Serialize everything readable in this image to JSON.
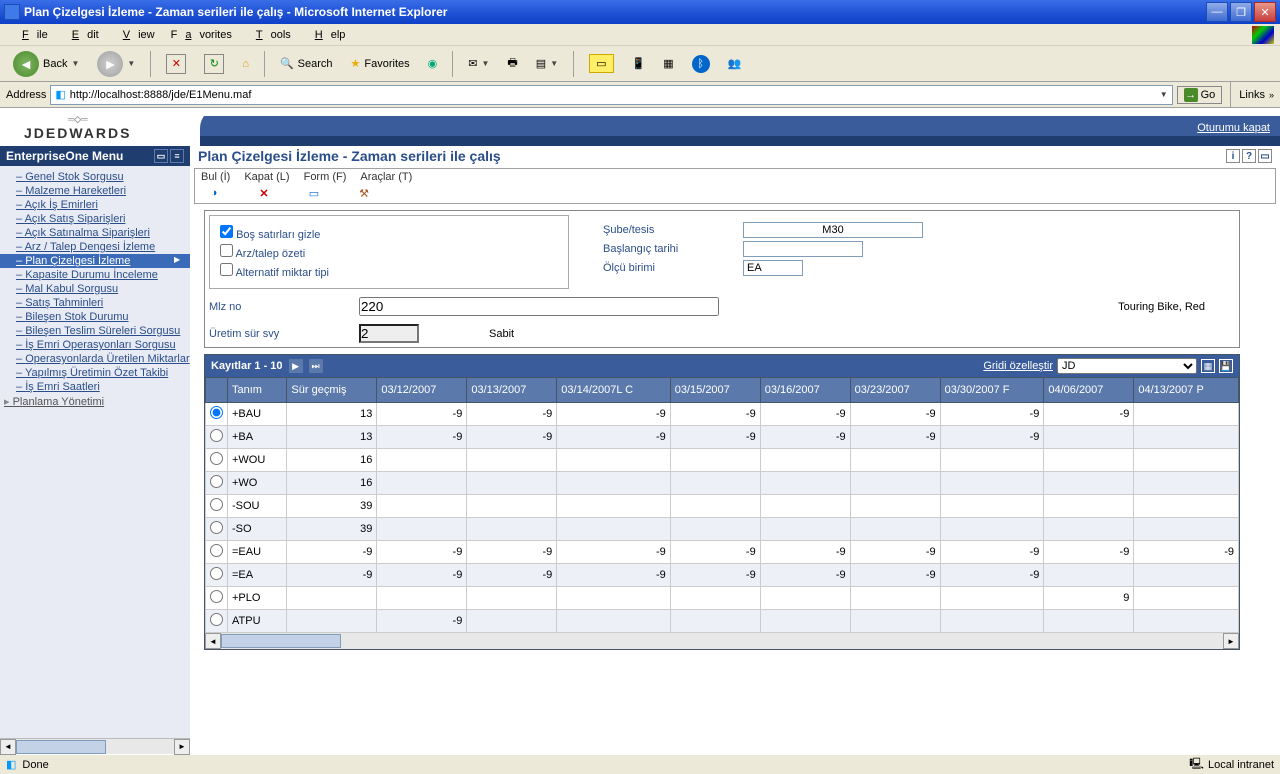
{
  "window": {
    "title": "Plan Çizelgesi İzleme - Zaman serileri ile çalış - Microsoft Internet Explorer"
  },
  "menubar": [
    "File",
    "Edit",
    "View",
    "Favorites",
    "Tools",
    "Help"
  ],
  "toolbar": {
    "back": "Back",
    "search": "Search",
    "favorites": "Favorites"
  },
  "address": {
    "label": "Address",
    "url": "http://localhost:8888/jde/E1Menu.maf",
    "go": "Go",
    "links": "Links"
  },
  "logo": {
    "main": "JDEDWARDS"
  },
  "logout": "Oturumu kapat",
  "sidebar": {
    "title": "EnterpriseOne Menu",
    "items": [
      "Genel Stok Sorgusu",
      "Malzeme Hareketleri",
      "Açık İş Emirleri",
      "Açık Satış Siparişleri",
      "Açık Satınalma Siparişleri",
      "Arz / Talep Dengesi İzleme",
      "Plan Çizelgesi İzleme",
      "Kapasite Durumu İnceleme",
      "Mal Kabul Sorgusu",
      "Satış Tahminleri",
      "Bileşen Stok Durumu",
      "Bileşen Teslim Süreleri Sorgusu",
      "İş Emri Operasyonları Sorgusu",
      "Operasyonlarda Üretilen Miktarlar",
      "Yapılmış Üretimin Özet Takibi",
      "İş Emri Saatleri"
    ],
    "sub": "Planlama Yönetimi",
    "selectedIndex": 6
  },
  "page": {
    "title": "Plan Çizelgesi İzleme - Zaman serileri ile çalış",
    "actions": {
      "bul": "Bul (İ)",
      "kapat": "Kapat (L)",
      "form": "Form (F)",
      "araclar": "Araçlar (T)"
    }
  },
  "form": {
    "chk_bos": "Boş satırları gizle",
    "chk_arz": "Arz/talep özeti",
    "chk_alt": "Alternatif miktar tipi",
    "sube_lbl": "Şube/tesis",
    "sube_val": "M30",
    "basl_lbl": "Başlangıç tarihi",
    "basl_val": "",
    "olcu_lbl": "Ölçü birimi",
    "olcu_val": "EA",
    "mlz_lbl": "Mlz no",
    "mlz_val": "220",
    "desc": "Touring Bike, Red",
    "uretim_lbl": "Üretim sür svy",
    "uretim_val": "2",
    "sabit": "Sabit"
  },
  "grid": {
    "records_label": "Kayıtlar 1 - 10",
    "customize": "Gridi özelleştir",
    "view_sel": "JD",
    "cols": [
      "Tanım",
      "Sür geçmiş",
      "03/12/2007",
      "03/13/2007",
      "03/14/2007L C",
      "03/15/2007",
      "03/16/2007",
      "03/23/2007",
      "03/30/2007 F",
      "04/06/2007",
      "04/13/2007 P"
    ],
    "rows": [
      {
        "t": "+BAU",
        "v": [
          "13",
          "-9",
          "-9",
          "-9",
          "-9",
          "-9",
          "-9",
          "-9",
          "-9",
          ""
        ]
      },
      {
        "t": "+BA",
        "v": [
          "13",
          "-9",
          "-9",
          "-9",
          "-9",
          "-9",
          "-9",
          "-9",
          "",
          ""
        ]
      },
      {
        "t": "+WOU",
        "v": [
          "16",
          "",
          "",
          "",
          "",
          "",
          "",
          "",
          "",
          ""
        ]
      },
      {
        "t": "+WO",
        "v": [
          "16",
          "",
          "",
          "",
          "",
          "",
          "",
          "",
          "",
          ""
        ]
      },
      {
        "t": "-SOU",
        "v": [
          "39",
          "",
          "",
          "",
          "",
          "",
          "",
          "",
          "",
          ""
        ]
      },
      {
        "t": "-SO",
        "v": [
          "39",
          "",
          "",
          "",
          "",
          "",
          "",
          "",
          "",
          ""
        ]
      },
      {
        "t": "=EAU",
        "v": [
          "-9",
          "-9",
          "-9",
          "-9",
          "-9",
          "-9",
          "-9",
          "-9",
          "-9",
          "-9"
        ]
      },
      {
        "t": "=EA",
        "v": [
          "-9",
          "-9",
          "-9",
          "-9",
          "-9",
          "-9",
          "-9",
          "-9",
          "",
          ""
        ]
      },
      {
        "t": "+PLO",
        "v": [
          "",
          "",
          "",
          "",
          "",
          "",
          "",
          "",
          "9",
          ""
        ]
      },
      {
        "t": "ATPU",
        "v": [
          "",
          "-9",
          "",
          "",
          "",
          "",
          "",
          "",
          "",
          ""
        ]
      }
    ]
  },
  "status": {
    "done": "Done",
    "zone": "Local intranet"
  }
}
